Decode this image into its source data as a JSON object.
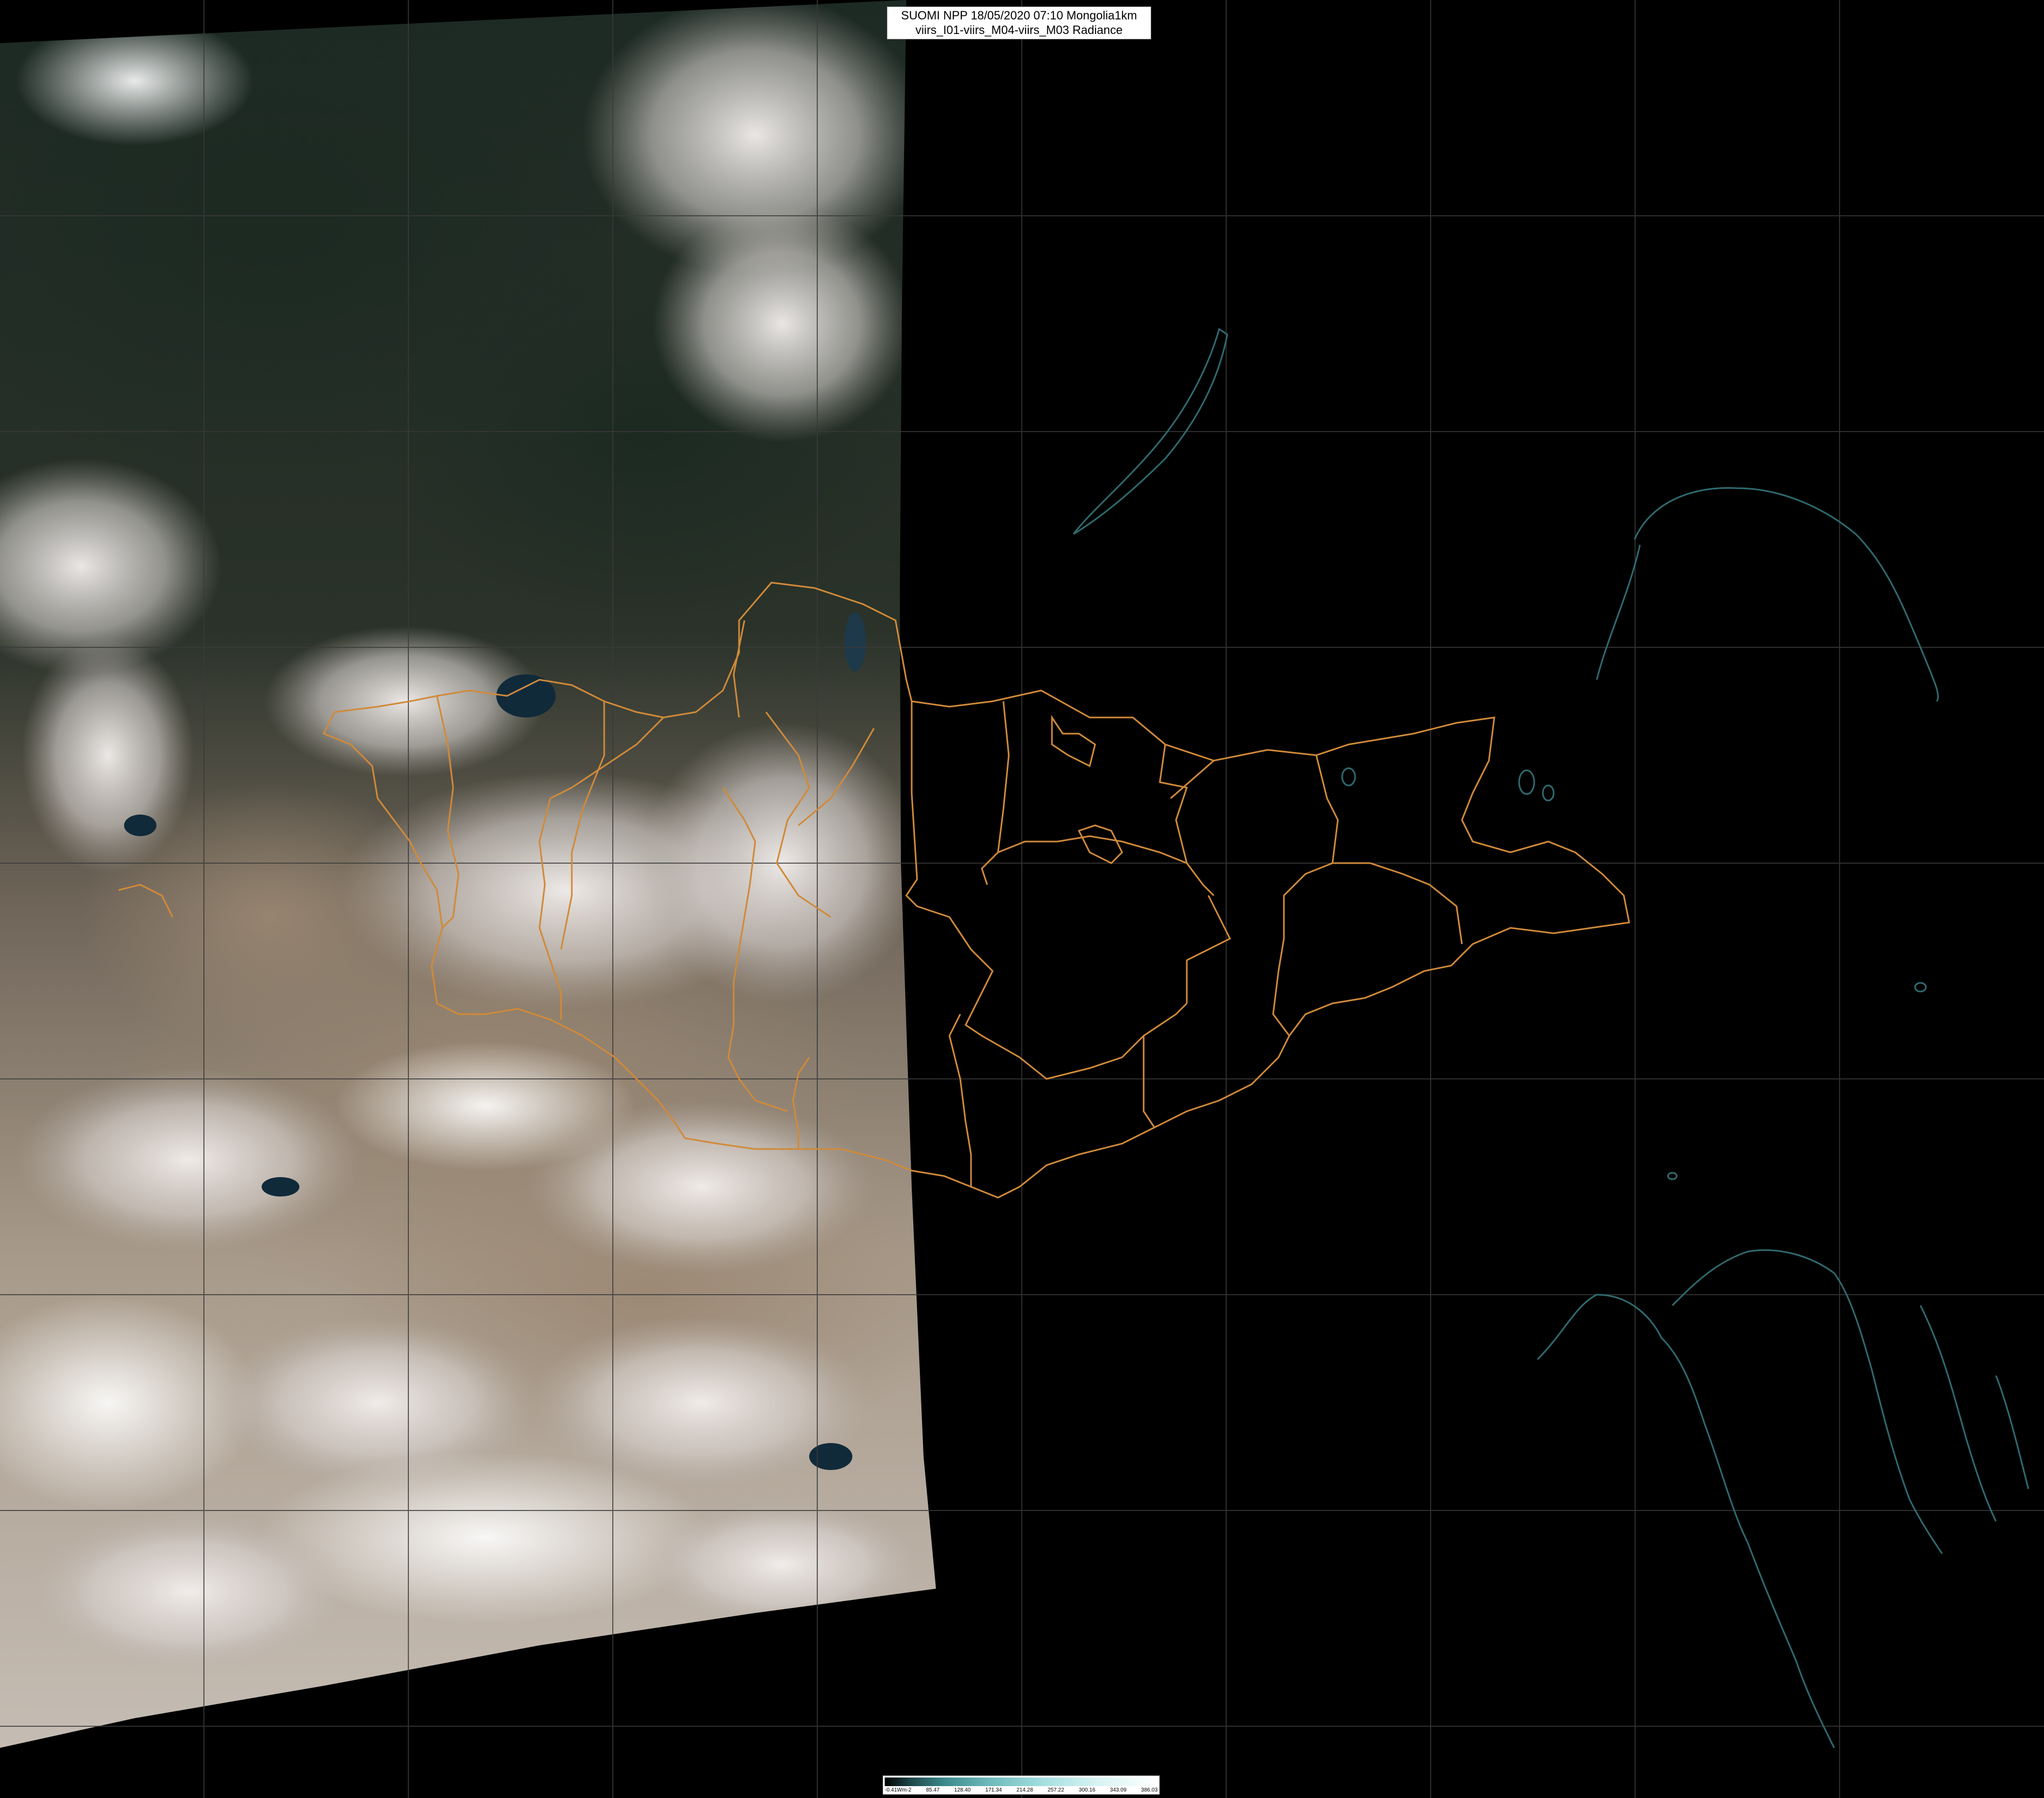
{
  "title": {
    "line1": "SUOMI NPP 18/05/2020 07:10 Mongolia1km",
    "line2": "viirs_I01-viirs_M04-viirs_M03 Radiance"
  },
  "colorbar": {
    "ticks": [
      "-0.41Wm-2",
      "85.47",
      "128.40",
      "171.34",
      "214.28",
      "257.22",
      "300.16",
      "343.09",
      "386.03"
    ]
  },
  "colors": {
    "background": "#000000",
    "grid": "#3a3a3a",
    "coastline": "#2f6a70",
    "boundary": "#d08a3a"
  }
}
